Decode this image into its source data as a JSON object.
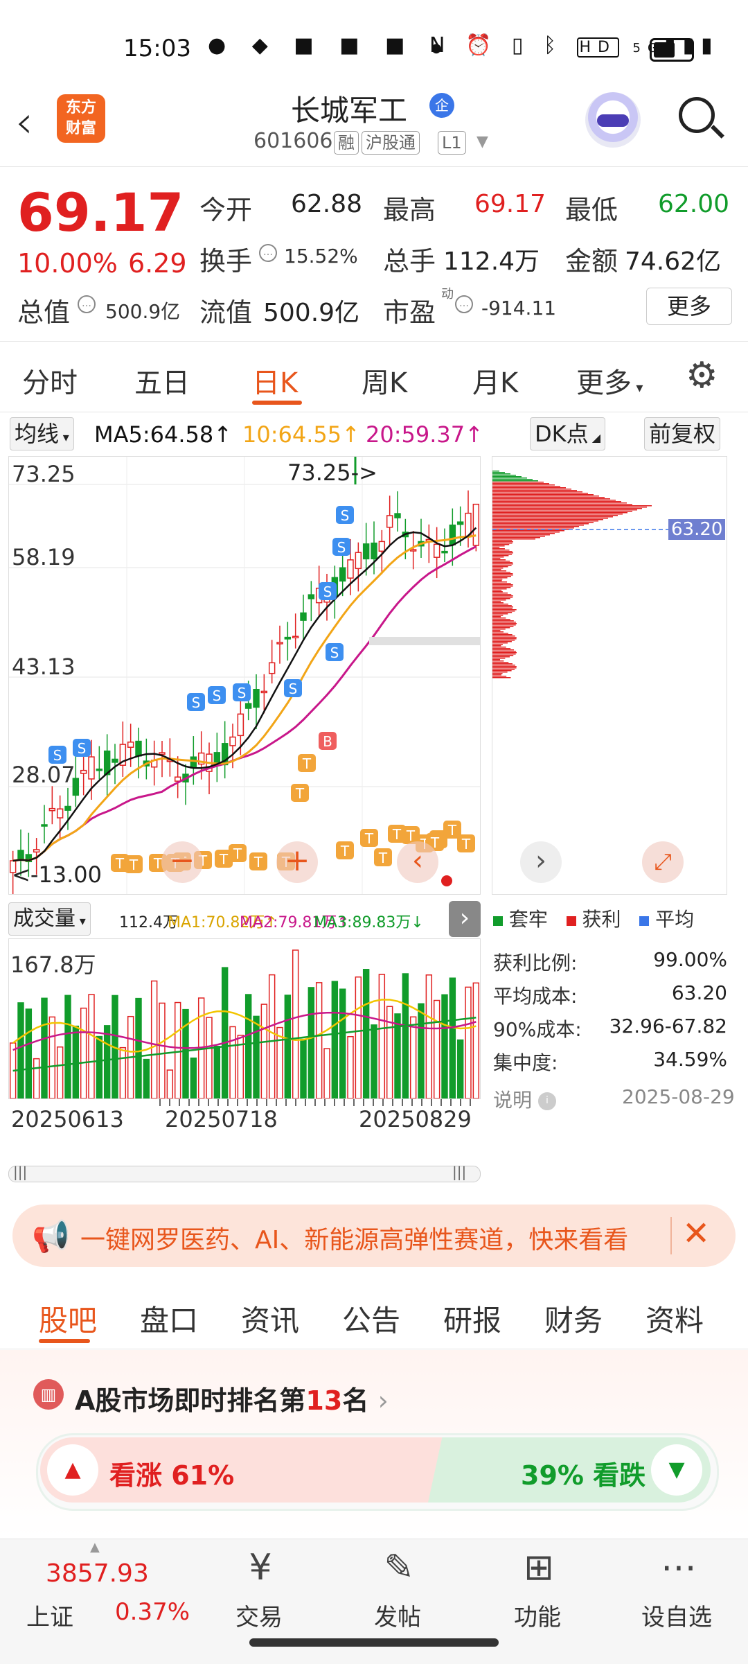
{
  "status_bar": {
    "time": "15:03",
    "app_icons": [
      "wechat-icon",
      "baidu-icon",
      "app-icon",
      "tieba-icon",
      "pay-icon"
    ],
    "right_icons": [
      "nfc-icon",
      "alarm-icon",
      "vibrate-icon",
      "bluetooth-icon",
      "hd-icon",
      "signal-5g-icon",
      "battery-icon"
    ],
    "hd": "HD",
    "net": "5G"
  },
  "header": {
    "logo_line1": "东方",
    "logo_line2": "财富",
    "stock_name": "长城军工",
    "qi_badge": "企",
    "stock_code": "601606",
    "tags": [
      "融",
      "沪股通",
      "L1"
    ]
  },
  "quote": {
    "price": "69.17",
    "change_pct": "10.00%",
    "change": "6.29",
    "open_label": "今开",
    "open": "62.88",
    "high_label": "最高",
    "high": "69.17",
    "low_label": "最低",
    "low": "62.00",
    "turnover_label": "换手",
    "turnover": "15.52%",
    "volume_label": "总手",
    "volume": "112.4万",
    "amount_label": "金额",
    "amount": "74.62亿",
    "mktcap_label": "总值",
    "mktcap": "500.9亿",
    "float_label": "流值",
    "float": "500.9亿",
    "pe_label": "市盈",
    "pe_sup": "动",
    "pe": "-914.11",
    "more": "更多"
  },
  "kline_tabs": [
    "分时",
    "五日",
    "日K",
    "周K",
    "月K",
    "更多"
  ],
  "active_tab": 2,
  "ma_legend": {
    "button": "均线",
    "ma5": "MA5:64.58",
    "ma10": "10:64.55",
    "ma20": "20:59.37",
    "dk_button": "DK点",
    "adjust_button": "前复权",
    "arrow": "↑"
  },
  "kchart": {
    "y_ticks": [
      "73.25",
      "58.19",
      "43.13",
      "28.07"
    ],
    "high_marker": "73.25->",
    "low_marker": "<-13.00",
    "colors": {
      "up": "#e02020",
      "down": "#119c2b",
      "ma5": "#111111",
      "ma10": "#f2a516",
      "ma20": "#c8178a",
      "signal_s": "#3d8ff0",
      "signal_t": "#f2a53a",
      "signal_b": "#ef5e5e"
    }
  },
  "chip": {
    "avg_price": "63.20",
    "legend": [
      "套牢",
      "获利",
      "平均"
    ],
    "stats": [
      {
        "label": "获利比例:",
        "value": "99.00%"
      },
      {
        "label": "平均成本:",
        "value": "63.20"
      },
      {
        "label": "90%成本:",
        "value": "32.96-67.82"
      },
      {
        "label": "集中度:",
        "value": "34.59%"
      }
    ],
    "note": "说明",
    "date": "2025-08-29"
  },
  "volume": {
    "button": "成交量",
    "vol": "112.4万",
    "ma1": "MA1:70.82万↑",
    "ma2": "MA2:79.81万↑",
    "ma3": "MA3:89.83万↓",
    "y_top": "167.8万",
    "dates": [
      "20250613",
      "20250718",
      "20250829"
    ]
  },
  "banner": {
    "text": "一键网罗医药、AI、新能源高弹性赛道，快来看看"
  },
  "bottom_tabs": [
    "股吧",
    "盘口",
    "资讯",
    "公告",
    "研报",
    "财务",
    "资料"
  ],
  "rank": {
    "prefix": "A股市场即时排名第",
    "rank": "13",
    "suffix": "名"
  },
  "sentiment": {
    "up": "看涨 61%",
    "down": "39% 看跌"
  },
  "nav": {
    "index_value": "3857.93",
    "index_name": "上证",
    "index_change": "0.37%",
    "items": [
      "交易",
      "发帖",
      "功能",
      "设自选"
    ]
  }
}
